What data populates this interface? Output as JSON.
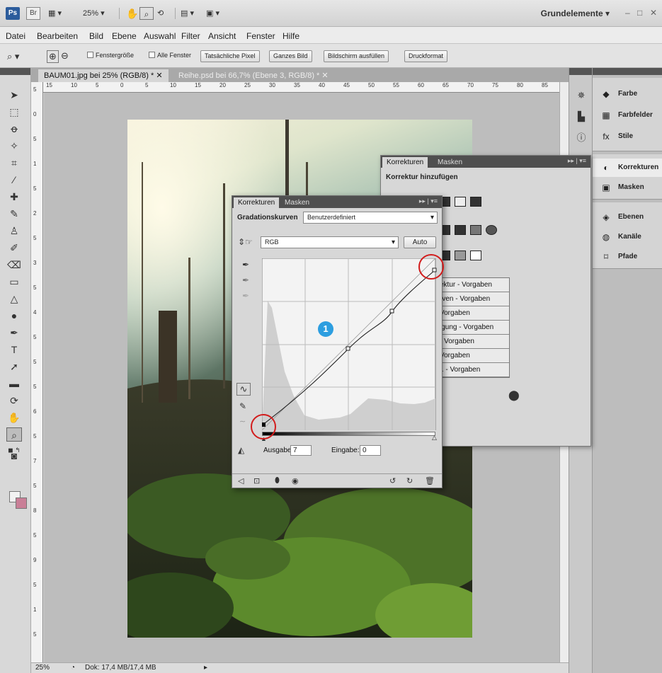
{
  "app": {
    "logo": "Ps",
    "bridge": "Br",
    "zoom": "25%",
    "workspace": "Grundelemente",
    "window_controls": [
      "–",
      "□",
      "✕"
    ]
  },
  "menu": [
    "Datei",
    "Bearbeiten",
    "Bild",
    "Ebene",
    "Auswahl",
    "Filter",
    "Ansicht",
    "Fenster",
    "Hilfe"
  ],
  "options": {
    "fenstergroesse": "Fenstergröße",
    "alle_fenster": "Alle Fenster",
    "buttons": [
      "Tatsächliche Pixel",
      "Ganzes Bild",
      "Bildschirm ausfüllen",
      "Druckformat"
    ]
  },
  "doc_tabs": [
    {
      "label": "BAUM01.jpg bei 25% (RGB/8) *",
      "active": true
    },
    {
      "label": "Reihe.psd bei 66,7% (Ebene 3, RGB/8) *",
      "active": false
    }
  ],
  "ruler": {
    "h": [
      "15",
      "10",
      "5",
      "0",
      "5",
      "10",
      "15",
      "20",
      "25",
      "30",
      "35",
      "40",
      "45",
      "50",
      "55",
      "60",
      "65",
      "70",
      "75",
      "80",
      "85"
    ],
    "v": [
      "5",
      "0",
      "5",
      "1",
      "5",
      "2",
      "5",
      "3",
      "5",
      "4",
      "5",
      "5",
      "5",
      "6",
      "5",
      "7",
      "5",
      "8",
      "5",
      "9",
      "5",
      "1",
      "5"
    ]
  },
  "status": {
    "zoom": "25%",
    "doc": "Dok: 17,4 MB/17,4 MB"
  },
  "dock": {
    "group1": [
      "Farbe",
      "Farbfelder",
      "Stile"
    ],
    "group2": [
      "Korrekturen",
      "Masken"
    ],
    "group3": [
      "Ebenen",
      "Kanäle",
      "Pfade"
    ]
  },
  "back_panel": {
    "tabs": [
      "Korrekturen",
      "Masken"
    ],
    "title": "Korrektur hinzufügen",
    "presets": [
      "ektur - Vorgaben",
      "rven - Vorgaben",
      "Vorgaben",
      "igung - Vorgaben",
      "- Vorgaben",
      "Vorgaben",
      "r. - Vorgaben"
    ]
  },
  "curves_panel": {
    "tabs": [
      "Korrekturen",
      "Masken"
    ],
    "label": "Gradationskurven",
    "preset": "Benutzerdefiniert",
    "channel": "RGB",
    "auto": "Auto",
    "ausgabe_label": "Ausgabe:",
    "ausgabe_value": "7",
    "eingabe_label": "Eingabe:",
    "eingabe_value": "0"
  },
  "callout": "1",
  "colors": {
    "accent_callout": "#2d9ee0",
    "highlight_ring": "#d21c1c",
    "background_swatch": "#c97f97"
  }
}
